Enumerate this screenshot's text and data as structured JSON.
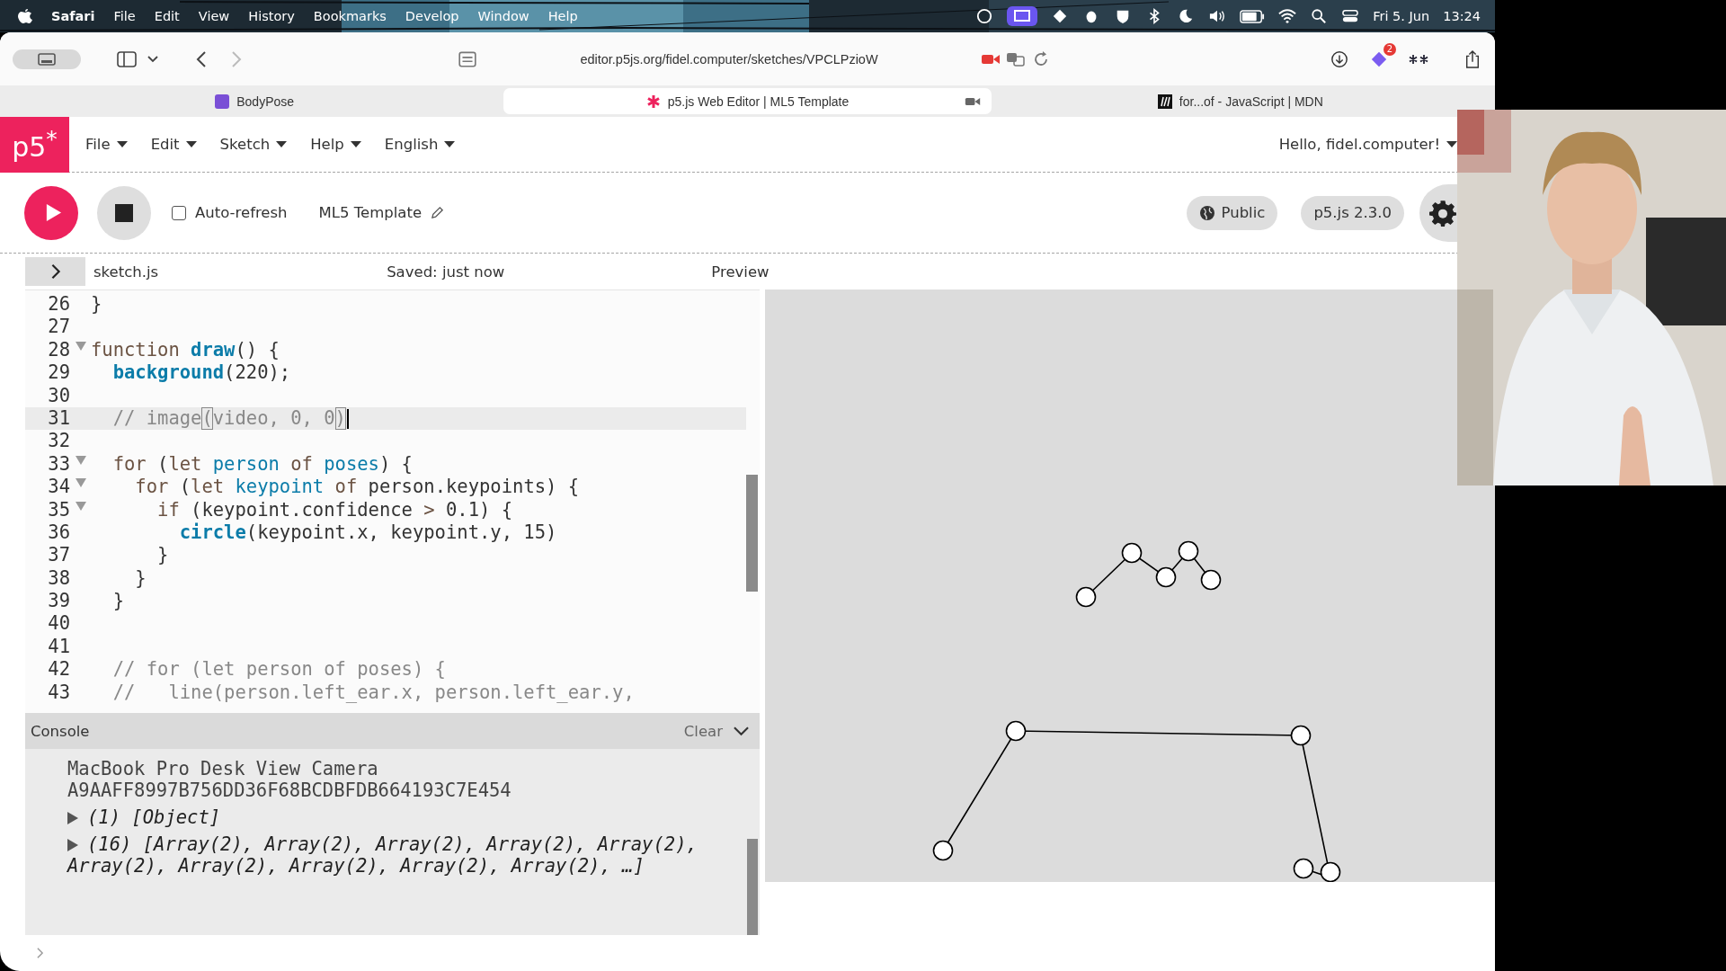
{
  "menubar": {
    "items": [
      {
        "label": "Safari",
        "kind": "app"
      },
      {
        "label": "File",
        "kind": "menu"
      },
      {
        "label": "Edit",
        "kind": "menu"
      },
      {
        "label": "View",
        "kind": "menu"
      },
      {
        "label": "History",
        "kind": "menu"
      },
      {
        "label": "Bookmarks",
        "kind": "menu"
      },
      {
        "label": "Develop",
        "kind": "menu"
      },
      {
        "label": "Window",
        "kind": "menu"
      },
      {
        "label": "Help",
        "kind": "menu"
      }
    ],
    "date": "Fri 5. Jun",
    "time": "13:24"
  },
  "browser": {
    "url": "editor.p5js.org/fidel.computer/sketches/VPCLPzioW",
    "extension_badge": "2",
    "tabs": [
      {
        "title": "BodyPose",
        "selected": false,
        "kind": "ml5"
      },
      {
        "title": "p5.js Web Editor | ML5 Template",
        "selected": true,
        "kind": "p5"
      },
      {
        "title": "for...of - JavaScript | MDN",
        "selected": false,
        "kind": "mdn"
      }
    ]
  },
  "editor_nav": {
    "logo": "p5$^{*}$",
    "menus": [
      "File",
      "Edit",
      "Sketch",
      "Help",
      "English"
    ],
    "user": "Hello, fidel.computer!"
  },
  "toolbar": {
    "auto_refresh": {
      "label": "Auto-refresh",
      "checked": false
    },
    "sketch_name": "ML5 Template",
    "visibility": "Public",
    "version": "p5.js 2.3.0"
  },
  "file_header": {
    "file": "sketch.js",
    "status": "Saved: just now",
    "preview_label": "Preview"
  },
  "code_lines": [
    {
      "number": "26",
      "fold": false,
      "active": false,
      "tokens": [
        {
          "text": "}",
          "kind": "plain"
        }
      ]
    },
    {
      "number": "27",
      "fold": false,
      "active": false
    },
    {
      "number": "28",
      "fold": true,
      "active": false,
      "tokens": [
        {
          "text": "function ",
          "kind": "keyword"
        },
        {
          "text": "draw",
          "kind": "def"
        },
        {
          "text": "() {",
          "kind": "plain"
        }
      ]
    },
    {
      "number": "29",
      "fold": false,
      "active": false,
      "tokens": [
        {
          "text": "  background",
          "kind": "def"
        },
        {
          "text": "(220);",
          "kind": "plain"
        }
      ]
    },
    {
      "number": "30",
      "fold": false,
      "active": false
    },
    {
      "number": "31",
      "fold": false,
      "active": true,
      "tokens": [
        {
          "text": "  // image",
          "kind": "comment"
        },
        {
          "text": "(",
          "kind": "bracket"
        },
        {
          "text": "video, 0, 0",
          "kind": "comment"
        },
        {
          "text": ")",
          "kind": "bracket"
        }
      ]
    },
    {
      "number": "32",
      "fold": false,
      "active": false
    },
    {
      "number": "33",
      "fold": true,
      "active": false,
      "tokens": [
        {
          "text": "  for",
          "kind": "keyword"
        },
        {
          "text": " (",
          "kind": "plain"
        },
        {
          "text": "let ",
          "kind": "keyword"
        },
        {
          "text": "person",
          "kind": "variable"
        },
        {
          "text": " of ",
          "kind": "keyword"
        },
        {
          "text": "poses",
          "kind": "variable"
        },
        {
          "text": ") {",
          "kind": "plain"
        }
      ]
    },
    {
      "number": "34",
      "fold": true,
      "active": false,
      "tokens": [
        {
          "text": "    for",
          "kind": "keyword"
        },
        {
          "text": " (",
          "kind": "plain"
        },
        {
          "text": "let ",
          "kind": "keyword"
        },
        {
          "text": "keypoint",
          "kind": "variable"
        },
        {
          "text": " of",
          "kind": "keyword"
        },
        {
          "text": " person.keypoints) {",
          "kind": "plain"
        }
      ]
    },
    {
      "number": "35",
      "fold": true,
      "active": false,
      "tokens": [
        {
          "text": "      if",
          "kind": "keyword"
        },
        {
          "text": " (keypoint.confidence ",
          "kind": "plain"
        },
        {
          "text": ">",
          "kind": "operator"
        },
        {
          "text": " 0.1) {",
          "kind": "plain"
        }
      ]
    },
    {
      "number": "36",
      "fold": false,
      "active": false,
      "tokens": [
        {
          "text": "        circle",
          "kind": "def"
        },
        {
          "text": "(keypoint.x, keypoint.y, 15)",
          "kind": "plain"
        }
      ]
    },
    {
      "number": "37",
      "fold": false,
      "active": false,
      "tokens": [
        {
          "text": "      }",
          "kind": "plain"
        }
      ]
    },
    {
      "number": "38",
      "fold": false,
      "active": false,
      "tokens": [
        {
          "text": "    }",
          "kind": "plain"
        }
      ]
    },
    {
      "number": "39",
      "fold": false,
      "active": false,
      "tokens": [
        {
          "text": "  }",
          "kind": "plain"
        }
      ]
    },
    {
      "number": "40",
      "fold": false,
      "active": false
    },
    {
      "number": "41",
      "fold": false,
      "active": false
    },
    {
      "number": "42",
      "fold": false,
      "active": false,
      "tokens": [
        {
          "text": "  // for (let person of poses) {",
          "kind": "comment"
        }
      ]
    },
    {
      "number": "43",
      "fold": false,
      "active": false,
      "tokens": [
        {
          "text": "  //   line(person.left_ear.x, person.left_ear.y,",
          "kind": "comment"
        }
      ]
    }
  ],
  "console": {
    "title": "Console",
    "clear": "Clear",
    "entries": [
      {
        "kind": "text",
        "lines": [
          "MacBook Pro Desk View Camera",
          "A9AAFF8997B756DD36F68BCDBFDB664193C7E454"
        ]
      },
      {
        "kind": "object",
        "text": "(1) [Object]"
      },
      {
        "kind": "object",
        "text": "(16) [Array(2), Array(2), Array(2), Array(2), Array(2), Array(2), Array(2), Array(2), Array(2), Array(2), …]"
      }
    ]
  }
}
